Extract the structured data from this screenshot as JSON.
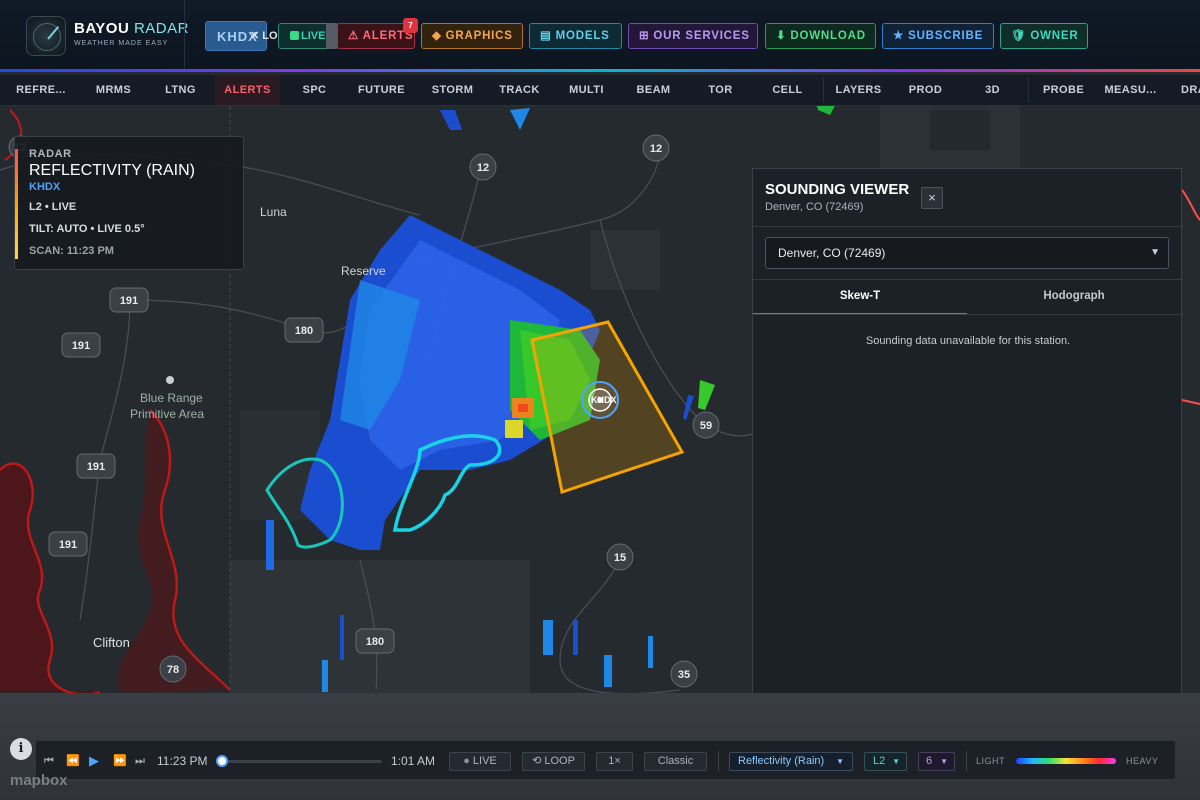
{
  "header": {
    "brand_main": "BAYOU ",
    "brand_accent": "RADAR",
    "tagline": "WEATHER MADE EASY",
    "station_code": "KHDX",
    "locate_label": "LOCATE",
    "live_label": "LIVE",
    "alerts_label": "⚠ ALERTS",
    "alerts_count": "7",
    "graphics_label": "◆ GRAPHICS",
    "models_label": "▤ MODELS",
    "services_label": "⊞ OUR SERVICES",
    "download_label": "⬇ DOWNLOAD",
    "subscribe_label": "★ SUBSCRIBE",
    "owner_label": "🛡 OWNER"
  },
  "toolbar": {
    "items": [
      "REFRE...",
      "MRMS",
      "LTNG",
      "ALERTS",
      "SPC",
      "FUTURE",
      "STORM",
      "TRACK",
      "MULTI",
      "BEAM",
      "TOR",
      "CELL",
      "LAYERS",
      "PROD",
      "3D",
      "PROBE",
      "MEASU...",
      "DRA"
    ],
    "active": "ALERTS"
  },
  "radar_info": {
    "category": "RADAR",
    "product": "REFLECTIVITY (RAIN)",
    "station": "KHDX",
    "mode": "L2 • LIVE",
    "tilt": "TILT: AUTO • LIVE 0.5°",
    "scan": "SCAN: 11:23 PM"
  },
  "map": {
    "places": [
      "Luna",
      "Reserve",
      "Blue Range",
      "Primitive Area",
      "Clifton"
    ],
    "route_shields": [
      "12",
      "12",
      "12",
      "191",
      "180",
      "191",
      "191",
      "191",
      "59",
      "15",
      "180",
      "78",
      "35"
    ],
    "radar_site_label": "KHDX"
  },
  "sounding": {
    "title": "SOUNDING VIEWER",
    "subtitle": "Denver, CO (72469)",
    "close_label": "×",
    "station_select": "Denver, CO (72469)",
    "tabs": [
      "Skew-T",
      "Hodograph"
    ],
    "active_tab": "Skew-T",
    "message": "Sounding data unavailable for this station."
  },
  "playbar": {
    "start_time": "11:23 PM",
    "end_time": "1:01 AM",
    "live_label": "LIVE",
    "loop_label": "LOOP",
    "speed": "1×",
    "style": "Classic",
    "product": "Reflectivity (Rain)",
    "level": "L2",
    "tilt_count": "6",
    "legend_low": "LIGHT",
    "legend_high": "HEAVY"
  },
  "attribution": {
    "info": "i",
    "mapbox": "mapbox"
  },
  "colors": {
    "accent_blue": "#4da3ff",
    "alert_red": "#ff5d6e",
    "warning_polygon": "#f5a300",
    "watch_polygon": "#19d3e6",
    "fire_boundary": "#c01818"
  }
}
